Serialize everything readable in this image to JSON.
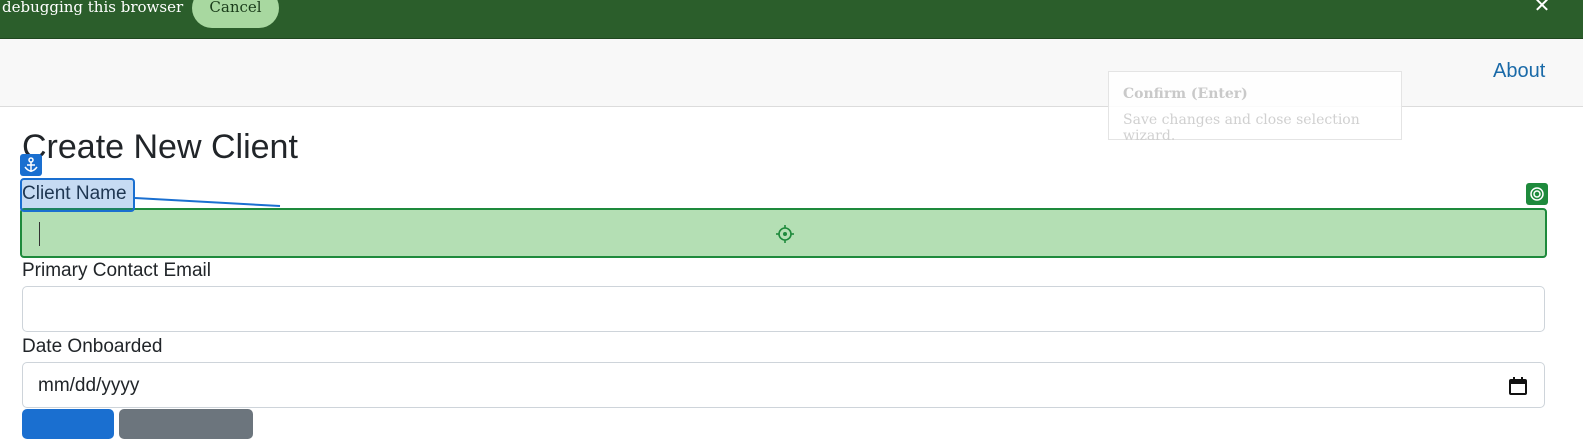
{
  "banner": {
    "message": "debugging this browser",
    "cancel_label": "Cancel",
    "close_glyph": "✕",
    "color": "#2b5e2b"
  },
  "navbar": {
    "about_label": "About"
  },
  "tooltip": {
    "title": "Confirm (Enter)",
    "description": "Save changes and close selection wizard."
  },
  "form": {
    "title": "Create New Client",
    "client_name_label": "Client Name",
    "client_name_value": "",
    "email_label": "Primary Contact Email",
    "email_value": "",
    "date_label": "Date Onboarded",
    "date_placeholder": "mm/dd/yyyy"
  },
  "overlay": {
    "anchor_icon": "anchor-icon",
    "target_icon": "crosshair-icon",
    "confirm_icon": "target-icon",
    "label_color": "#1a6fd0",
    "target_color": "#1e8a3c"
  },
  "icons": {
    "calendar": "calendar-icon",
    "close": "close-icon"
  }
}
